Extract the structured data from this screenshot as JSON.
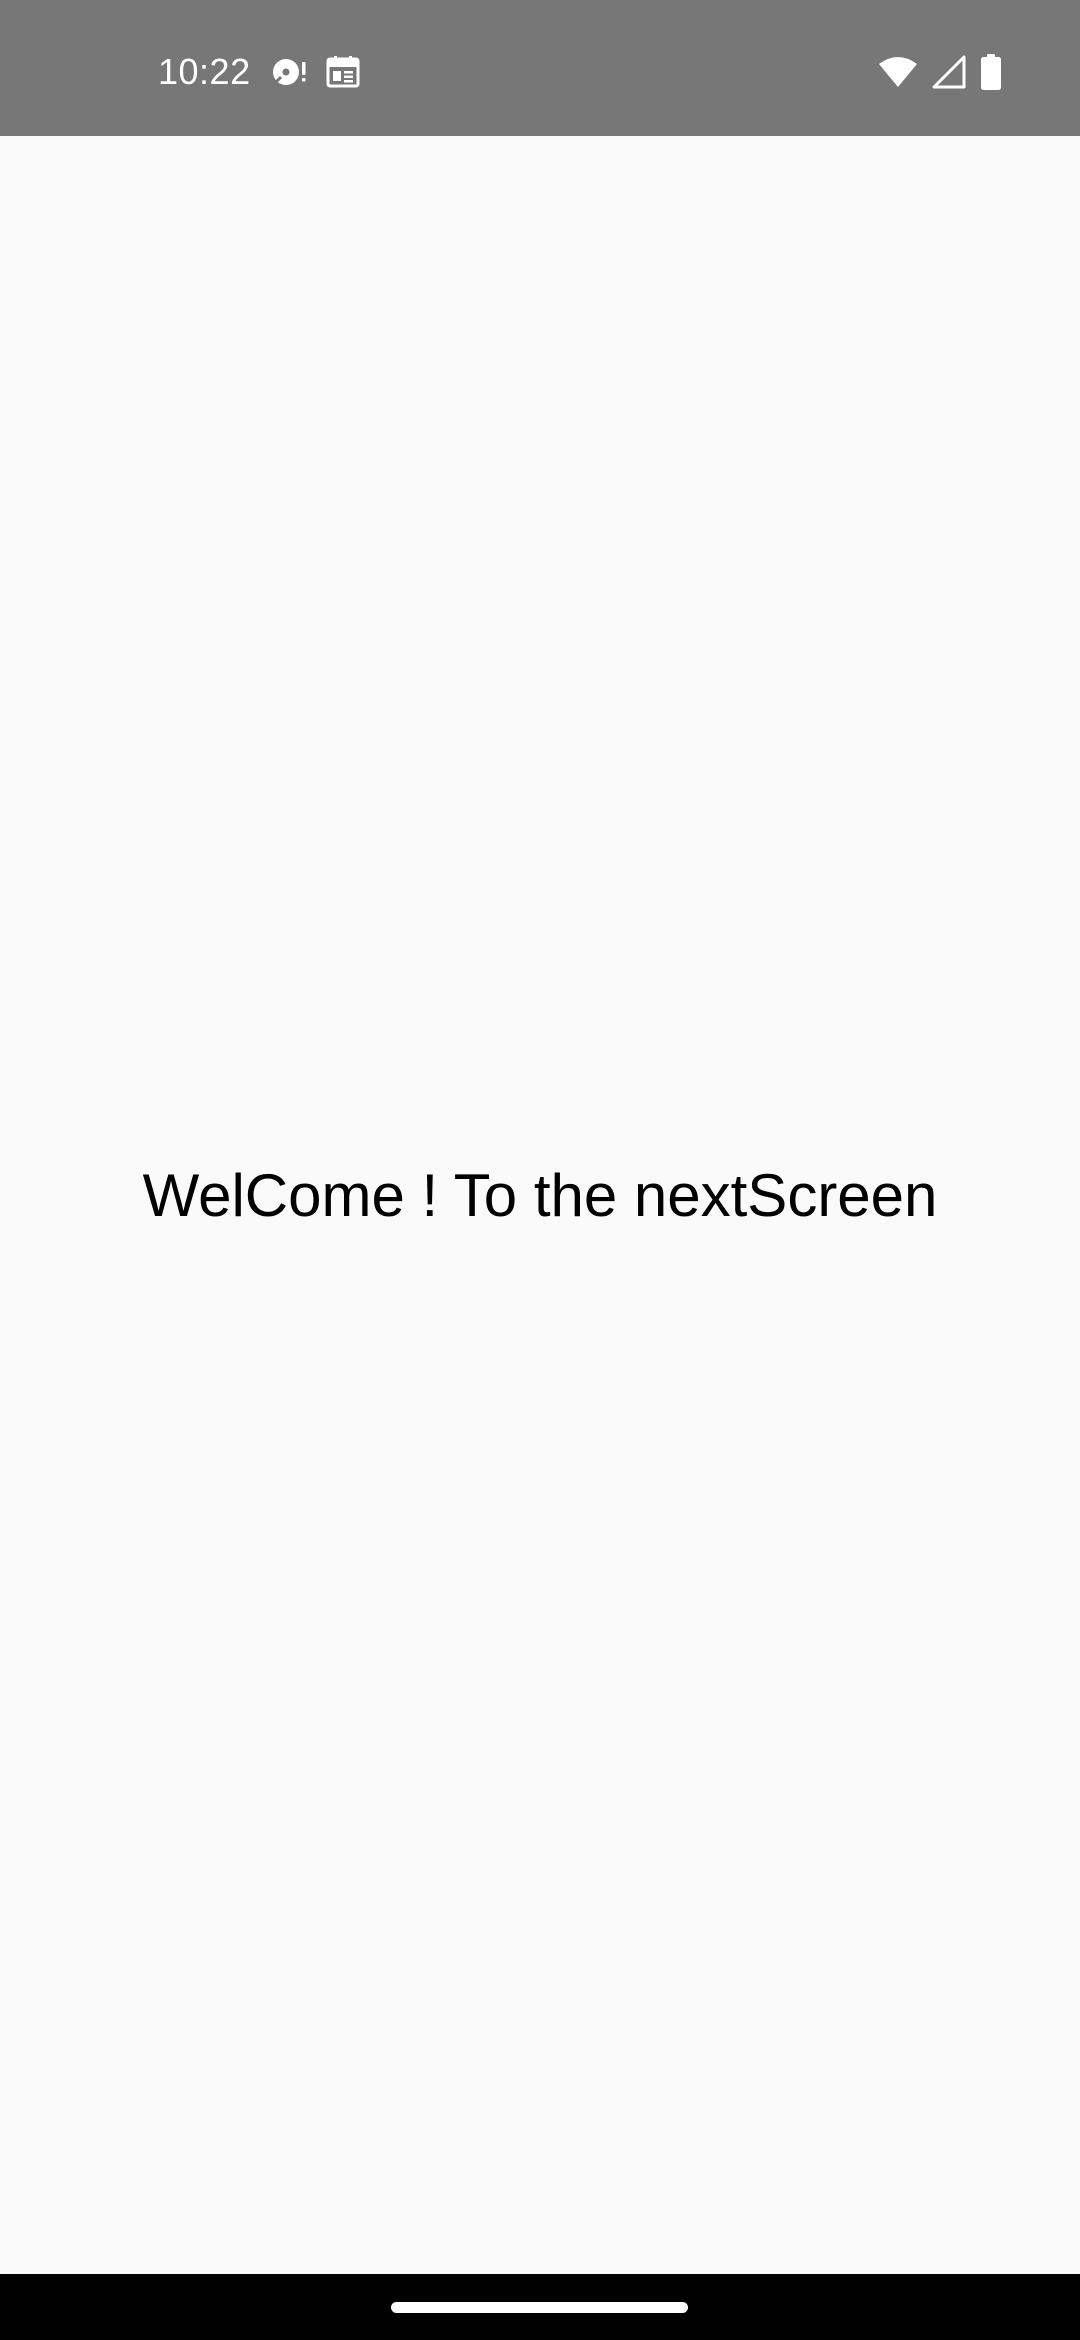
{
  "status_bar": {
    "time": "10:22",
    "background_color": "#777777",
    "left_icons": [
      "media-disc-alert-icon",
      "calendar-icon"
    ],
    "right_icons": [
      "wifi-icon",
      "cellular-signal-icon",
      "battery-icon"
    ]
  },
  "main": {
    "welcome_text": "WelCome ! To the nextScreen",
    "background_color": "#fafafa"
  },
  "navigation_bar": {
    "type": "gesture",
    "handle_icon": "gesture-handle-icon"
  }
}
